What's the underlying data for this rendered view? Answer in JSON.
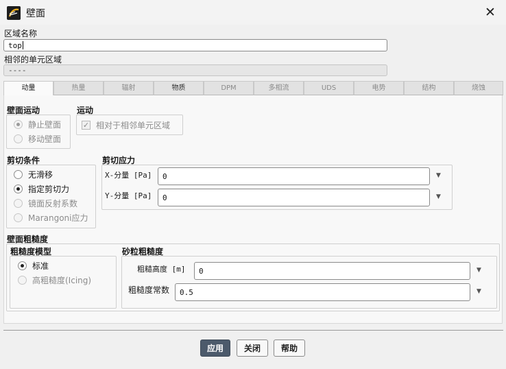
{
  "window": {
    "title": "壁面",
    "close_glyph": "✕"
  },
  "zone_name": {
    "label": "区域名称",
    "value": "top"
  },
  "adjacent_zone": {
    "label": "相邻的单元区域",
    "value": "----"
  },
  "tabs": [
    {
      "label": "动量",
      "active": true
    },
    {
      "label": "热量"
    },
    {
      "label": "辐射"
    },
    {
      "label": "物质"
    },
    {
      "label": "DPM"
    },
    {
      "label": "多相流"
    },
    {
      "label": "UDS"
    },
    {
      "label": "电势"
    },
    {
      "label": "结构"
    },
    {
      "label": "烧蚀"
    }
  ],
  "wall_motion": {
    "title": "壁面运动",
    "options": [
      {
        "label": "静止壁面",
        "checked": true
      },
      {
        "label": "移动壁面",
        "checked": false
      }
    ]
  },
  "motion": {
    "title": "运动",
    "checkbox_label": "相对于相邻单元区域",
    "checked": true
  },
  "shear_condition": {
    "title": "剪切条件",
    "options": [
      {
        "label": "无滑移",
        "checked": false
      },
      {
        "label": "指定剪切力",
        "checked": true
      },
      {
        "label": "镜面反射系数",
        "checked": false
      },
      {
        "label": "Marangoni应力",
        "checked": false
      }
    ]
  },
  "shear_stress": {
    "title": "剪切应力",
    "x": {
      "label": "X-分量 [Pa]",
      "value": "0"
    },
    "y": {
      "label": "Y-分量 [Pa]",
      "value": "0"
    }
  },
  "roughness": {
    "title": "壁面粗糙度",
    "model_title": "粗糙度模型",
    "model_options": [
      {
        "label": "标准",
        "checked": true
      },
      {
        "label": "高粗糙度(Icing)",
        "checked": false
      }
    ],
    "sand_title": "砂粒粗糙度",
    "height": {
      "label": "粗糙高度 [m]",
      "value": "0"
    },
    "constant": {
      "label": "粗糙度常数",
      "value": "0.5"
    }
  },
  "dropdown_glyph": "▼",
  "checkmark_glyph": "✓",
  "buttons": {
    "apply": "应用",
    "close": "关闭",
    "help": "帮助"
  },
  "icons": {
    "app": "ansys-fluent-logo-icon",
    "close": "close-icon",
    "dropdown": "chevron-down-icon"
  },
  "colors": {
    "primary_button": "#4c5a6b",
    "accent_yellow": "#f2b01e"
  }
}
